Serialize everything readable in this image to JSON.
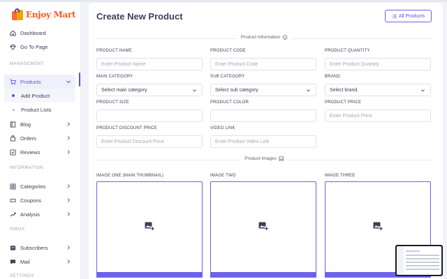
{
  "brand": {
    "name": "Enjoy Mart"
  },
  "sidebar": {
    "items_top": [
      {
        "label": "Dashboard",
        "icon": "home-icon"
      },
      {
        "label": "Go To Page",
        "icon": "diamond-icon"
      }
    ],
    "section_management": "MANAGEMENT",
    "products": {
      "label": "Products",
      "icon": "cart-icon"
    },
    "products_sub": [
      {
        "label": "Add Product",
        "active": true
      },
      {
        "label": "Product Lists",
        "active": false
      }
    ],
    "items_mgmt": [
      {
        "label": "Blog",
        "icon": "book-icon"
      },
      {
        "label": "Orders",
        "icon": "bag-icon"
      },
      {
        "label": "Reviews",
        "icon": "review-icon"
      }
    ],
    "section_information": "INFORMATION",
    "items_info": [
      {
        "label": "Categories",
        "icon": "grid-icon"
      },
      {
        "label": "Coupons",
        "icon": "ticket-icon"
      },
      {
        "label": "Analysis",
        "icon": "chart-icon"
      }
    ],
    "section_inbox": "INBOX",
    "items_inbox": [
      {
        "label": "Subscribers",
        "icon": "subscribers-icon"
      },
      {
        "label": "Mail",
        "icon": "mail-icon"
      }
    ],
    "section_settings": "SETTINGS"
  },
  "main": {
    "title": "Create New Product",
    "all_products_label": "All Products",
    "section_info": "Product Information",
    "section_images": "Product Images",
    "fields": {
      "name": {
        "label": "PRODUCT NAME",
        "placeholder": "Enter Product Name"
      },
      "code": {
        "label": "PRODUCT CODE",
        "placeholder": "Enter Product Code"
      },
      "quantity": {
        "label": "PRODUCT QUANTITY",
        "placeholder": "Enter Product Quantity"
      },
      "main_category": {
        "label": "MAIN CATEGORY",
        "value": "Select main category."
      },
      "sub_category": {
        "label": "SUB CATEGORY",
        "value": "Select sub category."
      },
      "brand": {
        "label": "BRAND",
        "value": "Select brand."
      },
      "size": {
        "label": "PRODUCT SIZE",
        "placeholder": ""
      },
      "color": {
        "label": "PRODUCT COLOR",
        "placeholder": ""
      },
      "price": {
        "label": "PRODUCT PRICE",
        "placeholder": "Enter Product Price"
      },
      "discount": {
        "label": "PRODUCT DISCOUNT PRICE",
        "placeholder": "Enter Product Discount Price"
      },
      "video": {
        "label": "VIDEO LINK",
        "placeholder": "Enter Product Video Link"
      }
    },
    "images": [
      {
        "label": "IMAGE ONE (MAIN THUMBNAIL)"
      },
      {
        "label": "IMAGE TWO"
      },
      {
        "label": "IMAGE THREE"
      }
    ]
  },
  "colors": {
    "accent": "#5b50e6",
    "brand": "#ff5a1f"
  }
}
